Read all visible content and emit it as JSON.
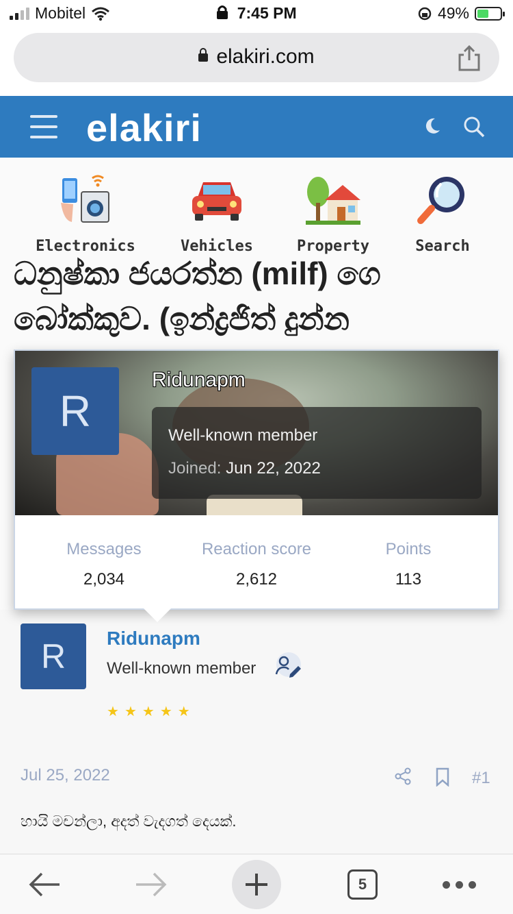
{
  "status_bar": {
    "carrier": "Mobitel",
    "time": "7:45 PM",
    "battery_percent": "49%",
    "battery_level": 0.49,
    "icons": [
      "signal-icon",
      "wifi-icon",
      "lock-icon",
      "orientation-lock-icon",
      "battery-icon"
    ]
  },
  "browser": {
    "url": "elakiri.com",
    "open_tabs": "5"
  },
  "header": {
    "logo": "elakiri",
    "color": "#2e7bbf"
  },
  "categories": [
    {
      "label": "Electronics",
      "icon": "electronics-icon"
    },
    {
      "label": "Vehicles",
      "icon": "car-icon"
    },
    {
      "label": "Property",
      "icon": "house-icon"
    },
    {
      "label": "Search",
      "icon": "magnifier-icon"
    }
  ],
  "thread": {
    "title": "ධනුෂ්කා ජයරත්න (milf) ගෙ බෝක්කුව. (ඉන්ද්‍රජිත් දුන්න"
  },
  "member_card": {
    "username": "Ridunapm",
    "avatar_letter": "R",
    "user_title": "Well-known member",
    "joined_label": "Joined:",
    "joined_date": "Jun 22, 2022",
    "stats": [
      {
        "label": "Messages",
        "value": "2,034"
      },
      {
        "label": "Reaction score",
        "value": "2,612"
      },
      {
        "label": "Points",
        "value": "113"
      }
    ]
  },
  "post": {
    "username": "Ridunapm",
    "avatar_letter": "R",
    "user_title": "Well-known member",
    "stars": 5,
    "date": "Jul 25, 2022",
    "number": "#1",
    "body": "හායි මචන්ලා, අදත් වැදගත් දෙයක්."
  }
}
